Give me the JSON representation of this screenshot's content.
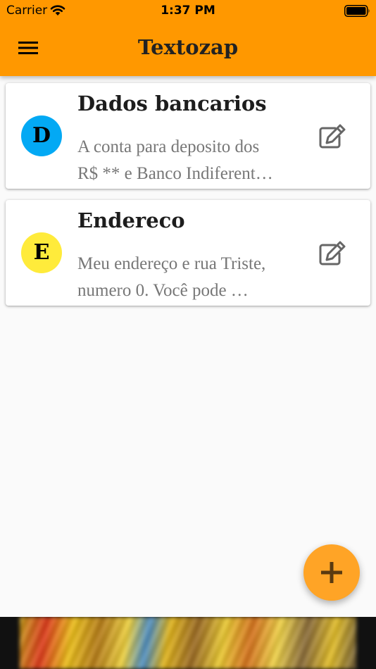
{
  "status_bar": {
    "carrier": "Carrier",
    "time": "1:37 PM",
    "wifi_icon": "wifi-icon",
    "battery_icon": "battery-icon"
  },
  "app_bar": {
    "title": "Textozap",
    "menu_icon": "menu-icon",
    "color": "#ff9800"
  },
  "notes": [
    {
      "avatar_letter": "D",
      "avatar_color": "#03a9f4",
      "title": "Dados bancarios",
      "body_line1": "A conta para deposito dos",
      "body_line2": "R$ ** e Banco Indiferent…",
      "action_icon": "edit-icon"
    },
    {
      "avatar_letter": "E",
      "avatar_color": "#ffeb3b",
      "title": "Endereco",
      "body_line1": "Meu endereço e rua Triste,",
      "body_line2": "numero 0. Você pode …",
      "action_icon": "edit-icon"
    }
  ],
  "fab": {
    "icon": "plus-icon",
    "color": "#ffa426"
  },
  "ad_banner": {
    "icon": "ad-image"
  }
}
